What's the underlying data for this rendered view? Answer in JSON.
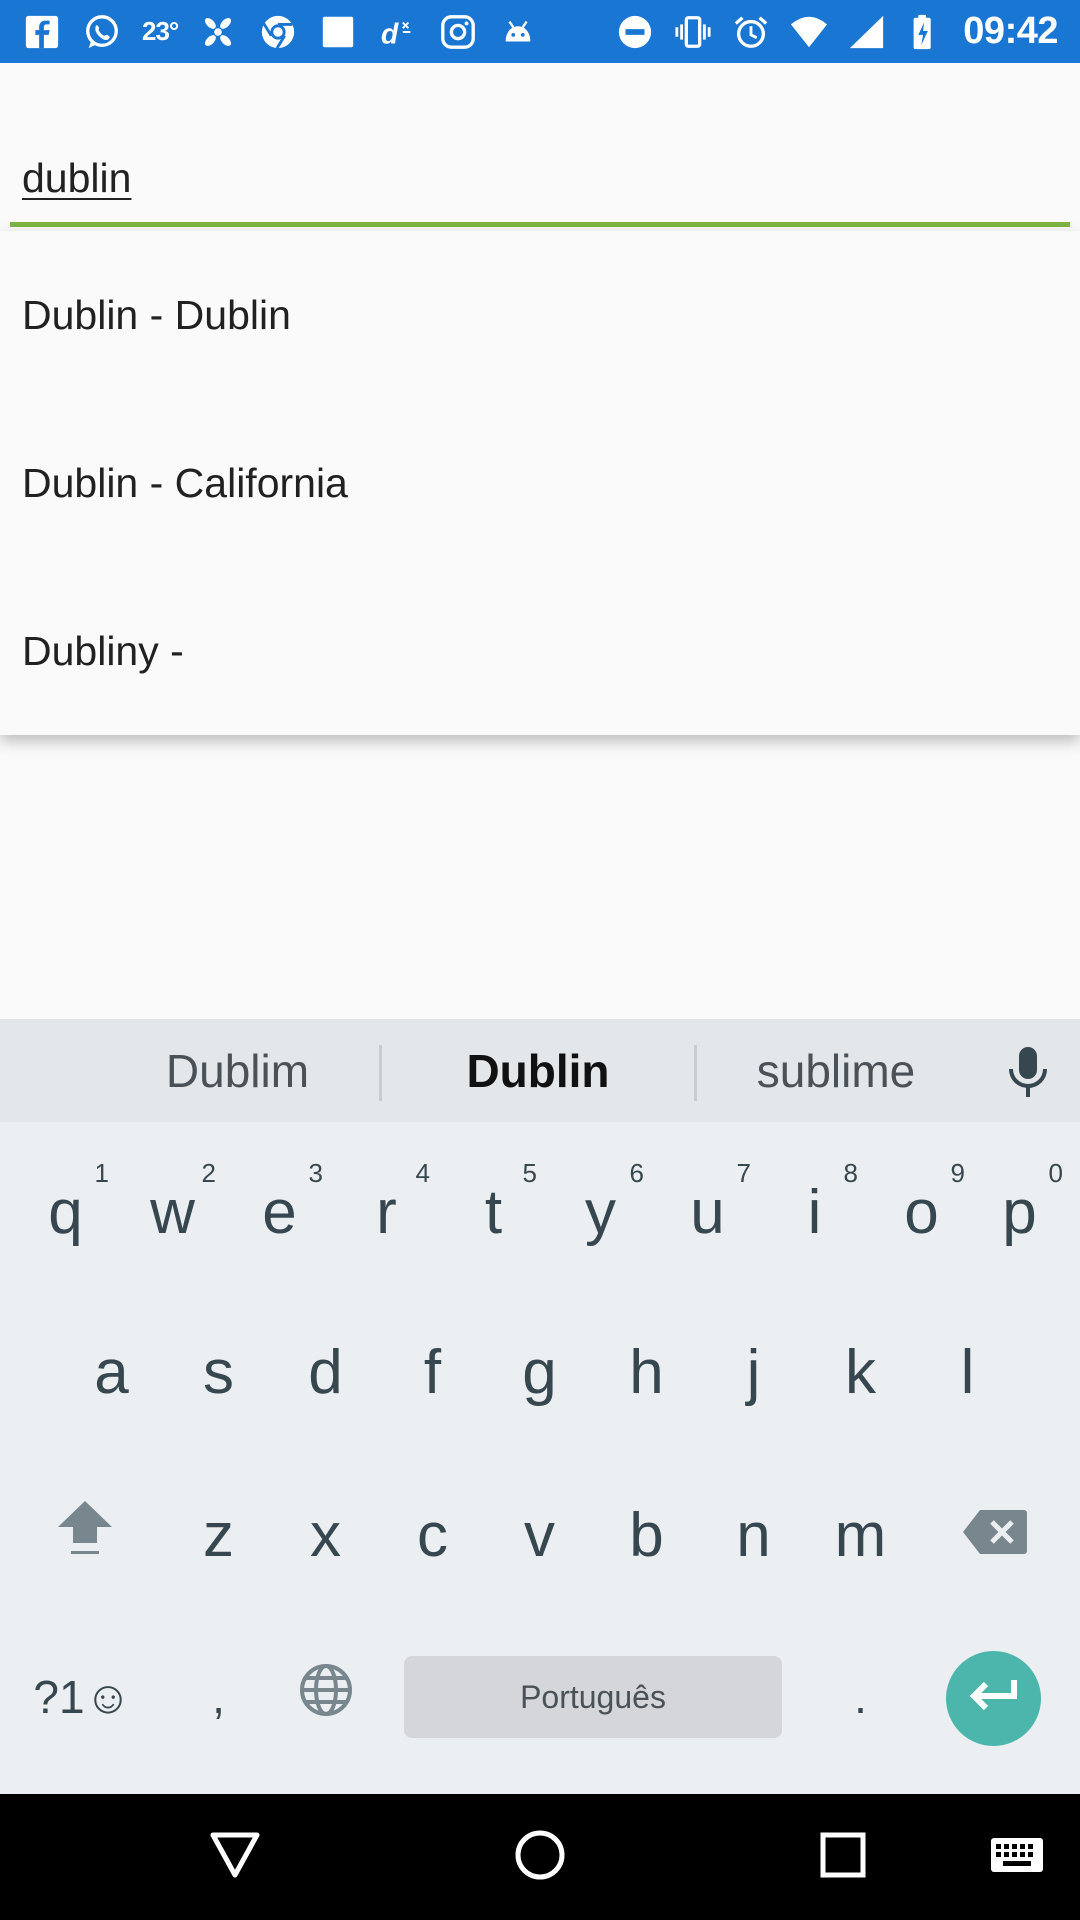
{
  "status_bar": {
    "temperature": "23°",
    "time": "09:42",
    "left_icons": [
      "facebook-icon",
      "whatsapp-icon",
      "weather-temp",
      "pinwheel-app-icon",
      "chrome-icon",
      "square-notification-icon",
      "deezer-icon",
      "instagram-icon",
      "android-icon"
    ],
    "right_icons": [
      "do-not-disturb-icon",
      "vibrate-icon",
      "alarm-icon",
      "wifi-icon",
      "signal-icon",
      "battery-charging-icon"
    ]
  },
  "search": {
    "value": "dublin",
    "underline_color": "#7cb342"
  },
  "suggestions": [
    {
      "label": "Dublin - Dublin"
    },
    {
      "label": "Dublin - California"
    },
    {
      "label": "Dubliny -"
    }
  ],
  "keyboard": {
    "word_suggestions": [
      "Dublim",
      "Dublin",
      "sublime"
    ],
    "row1": [
      {
        "key": "q",
        "hint": "1"
      },
      {
        "key": "w",
        "hint": "2"
      },
      {
        "key": "e",
        "hint": "3"
      },
      {
        "key": "r",
        "hint": "4"
      },
      {
        "key": "t",
        "hint": "5"
      },
      {
        "key": "y",
        "hint": "6"
      },
      {
        "key": "u",
        "hint": "7"
      },
      {
        "key": "i",
        "hint": "8"
      },
      {
        "key": "o",
        "hint": "9"
      },
      {
        "key": "p",
        "hint": "0"
      }
    ],
    "row2": [
      "a",
      "s",
      "d",
      "f",
      "g",
      "h",
      "j",
      "k",
      "l"
    ],
    "row3": [
      "z",
      "x",
      "c",
      "v",
      "b",
      "n",
      "m"
    ],
    "symbols_label": "?1☺",
    "comma": ",",
    "period": ".",
    "space_label": "Português",
    "enter_color": "#4db6ac"
  },
  "nav_bar": {
    "buttons": [
      "back-icon",
      "home-icon",
      "recents-icon",
      "keyboard-switch-icon"
    ]
  }
}
